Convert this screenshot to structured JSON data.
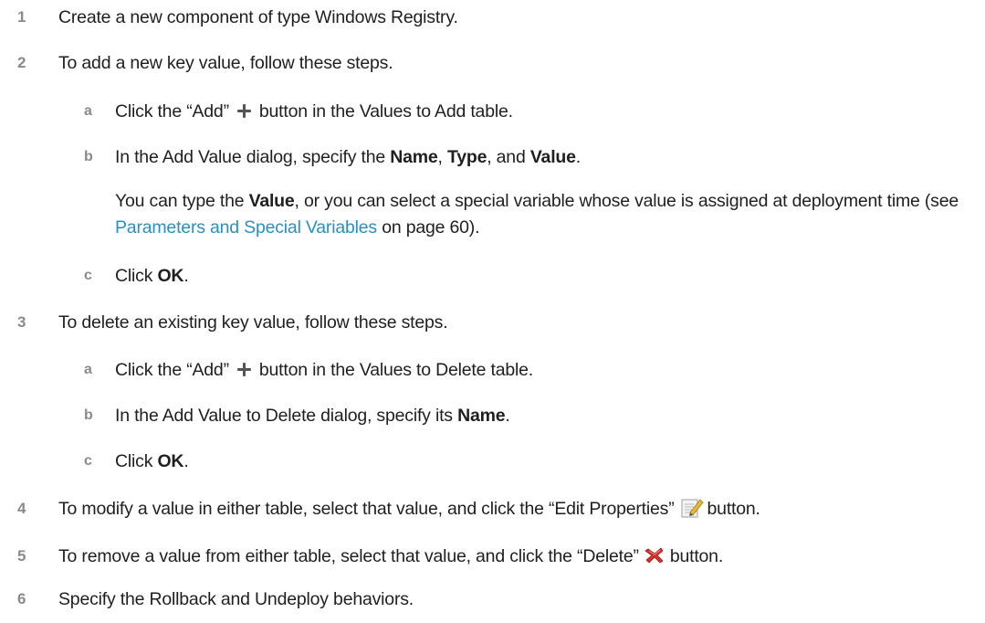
{
  "steps": {
    "s1": {
      "num": "1",
      "text": "Create a new component of type Windows Registry."
    },
    "s2": {
      "num": "2",
      "text": "To add a new key value, follow these steps.",
      "a": {
        "letter": "a",
        "pre": "Click the “Add”",
        "post": "button in the Values to Add table."
      },
      "b": {
        "letter": "b",
        "pre": "In the Add Value dialog, specify the ",
        "bold1": "Name",
        "mid1": ", ",
        "bold2": "Type",
        "mid2": ", and ",
        "bold3": "Value",
        "post": "."
      },
      "note": {
        "pre": "You can type the ",
        "bold": "Value",
        "mid": ", or you can select a special variable whose value is assigned at deployment time (see ",
        "link": "Parameters and Special Variables",
        "post": " on page 60)."
      },
      "c": {
        "letter": "c",
        "pre": "Click ",
        "bold": "OK",
        "post": "."
      }
    },
    "s3": {
      "num": "3",
      "text": "To delete an existing key value, follow these steps.",
      "a": {
        "letter": "a",
        "pre": "Click the “Add”",
        "post": "button in the Values to Delete table."
      },
      "b": {
        "letter": "b",
        "pre": "In the Add Value to Delete dialog, specify its ",
        "bold": "Name",
        "post": "."
      },
      "c": {
        "letter": "c",
        "pre": "Click ",
        "bold": "OK",
        "post": "."
      }
    },
    "s4": {
      "num": "4",
      "pre": "To modify a value in either table, select that value, and click the “Edit Properties”",
      "post": "button."
    },
    "s5": {
      "num": "5",
      "pre": "To remove a value from either table, select that value, and click the “Delete”",
      "post": "button."
    },
    "s6": {
      "num": "6",
      "text": "Specify the Rollback and Undeploy behaviors."
    }
  },
  "icons": {
    "add": "plus-icon",
    "edit": "edit-properties-icon",
    "delete": "delete-x-icon"
  },
  "colors": {
    "link": "#2b8fc4",
    "number": "#8a8a8a",
    "text": "#1f1f1f",
    "delete": "#d9302a"
  }
}
